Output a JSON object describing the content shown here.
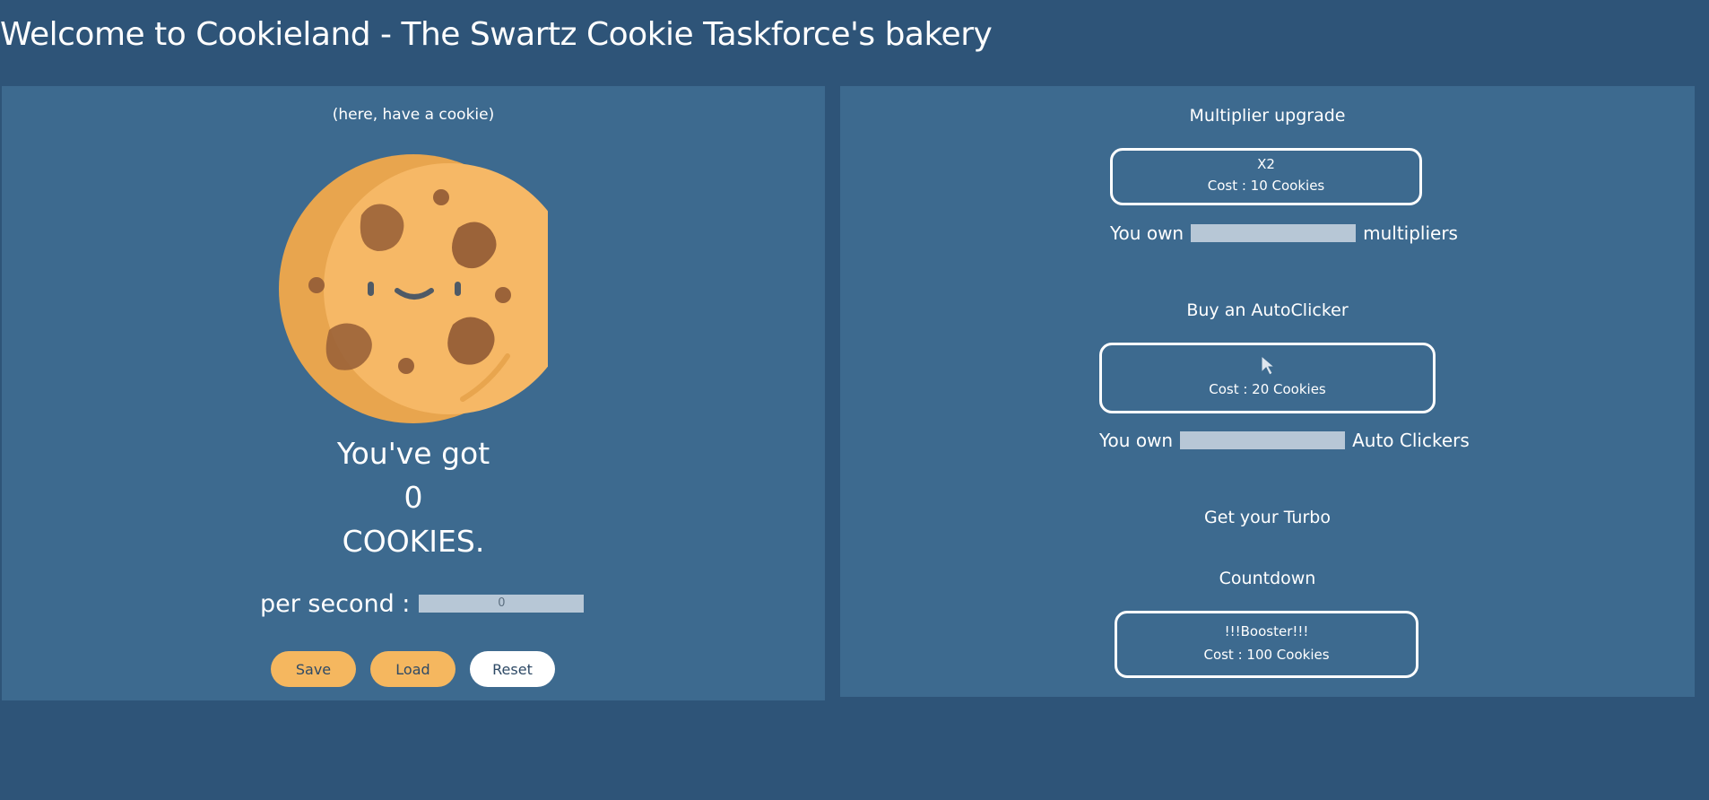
{
  "title": "Welcome to Cookieland - The Swartz Cookie Taskforce's bakery",
  "left": {
    "hint": "(here, have a cookie)",
    "got_label": "You've got",
    "cookie_count": "0",
    "cookies_label": "COOKIES.",
    "per_second_label": "per second :",
    "per_second_value": "0",
    "buttons": {
      "save": "Save",
      "load": "Load",
      "reset": "Reset"
    }
  },
  "right": {
    "multiplier": {
      "title": "Multiplier upgrade",
      "button_line1": "X2",
      "button_line2": "Cost : 10 Cookies",
      "own_prefix": "You own",
      "own_suffix": "multipliers"
    },
    "autoclicker": {
      "title": "Buy an AutoClicker",
      "button_icon": "cursor-icon",
      "button_line2": "Cost : 20 Cookies",
      "own_prefix": "You own",
      "own_suffix": "Auto Clickers"
    },
    "turbo": {
      "title": "Get your Turbo",
      "countdown_label": "Countdown",
      "button_line1": "!!!Booster!!!",
      "button_line2": "Cost : 100 Cookies"
    }
  },
  "colors": {
    "background": "#2e5478",
    "panel": "#3d6a8f",
    "accent": "#f5b75f",
    "field": "#b7c7d6"
  }
}
